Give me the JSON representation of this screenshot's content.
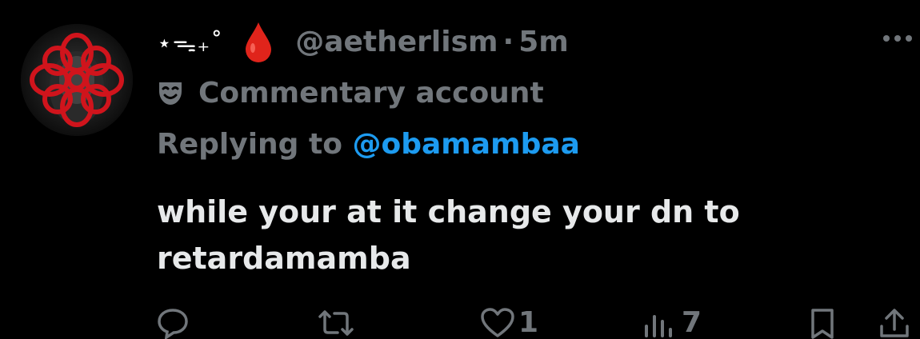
{
  "tweet": {
    "display_name_decoration": "⋆ᯓ₊˚",
    "handle": "@aetherlism",
    "separator": "·",
    "time": "5m",
    "label": "Commentary account",
    "reply_prefix": "Replying to ",
    "reply_handle": "@obamambaa",
    "text_line_1": "while your at it change your dn to",
    "text_line_2": "retardamamba"
  },
  "actions": {
    "reply_icon": "reply-icon",
    "retweet_icon": "retweet-icon",
    "like_icon": "heart-icon",
    "like_count": "1",
    "views_icon": "views-icon",
    "views_count": "7",
    "bookmark_icon": "bookmark-icon",
    "share_icon": "share-icon"
  },
  "colors": {
    "background": "#000000",
    "text_primary": "#e7e9ea",
    "text_secondary": "#71767b",
    "link": "#1d9bf0",
    "drop": "#e0241b"
  }
}
